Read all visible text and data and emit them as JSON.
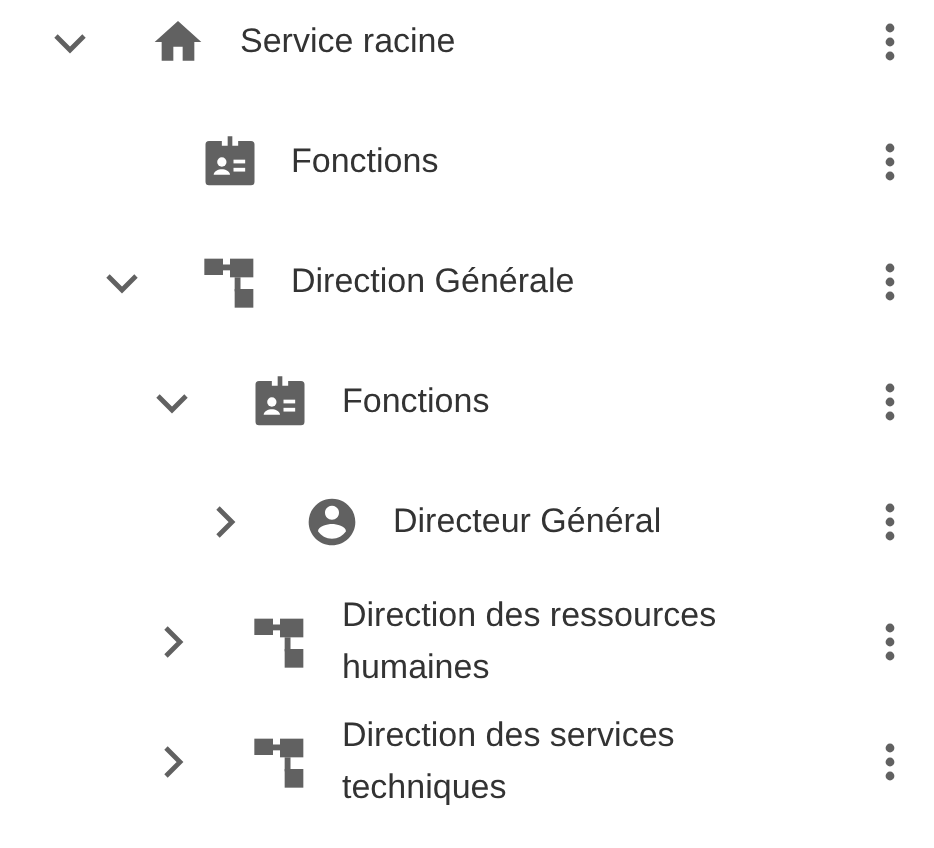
{
  "tree": [
    {
      "kind": "home",
      "label": "Service racine",
      "expandable": true,
      "expanded": true,
      "children": [
        {
          "kind": "functions",
          "label": "Fonctions",
          "expandable": false
        },
        {
          "kind": "org",
          "label": "Direction Générale",
          "expandable": true,
          "expanded": true,
          "children": [
            {
              "kind": "functions",
              "label": "Fonctions",
              "expandable": true,
              "expanded": true,
              "children": [
                {
                  "kind": "person",
                  "label": "Directeur Général",
                  "expandable": true,
                  "expanded": false
                }
              ]
            },
            {
              "kind": "org",
              "label": "Direction des ressources humaines",
              "expandable": true,
              "expanded": false
            },
            {
              "kind": "org",
              "label": "Direction des services techniques",
              "expandable": true,
              "expanded": false
            }
          ]
        }
      ]
    }
  ]
}
